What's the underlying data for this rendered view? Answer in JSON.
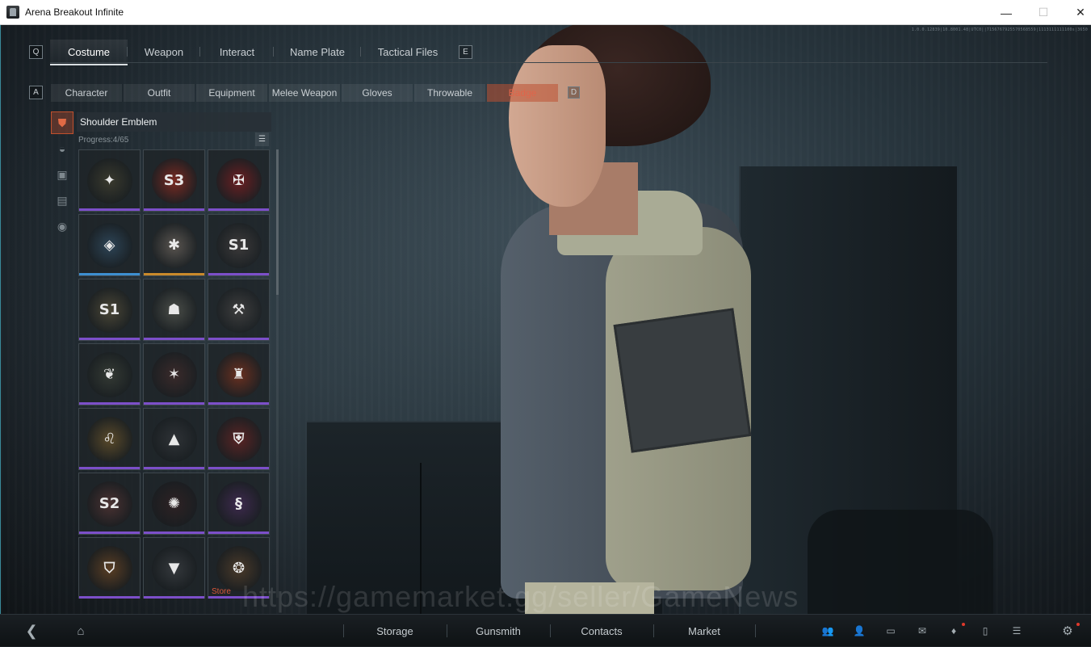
{
  "window": {
    "title": "Arena Breakout Infinite",
    "min": "—",
    "max": "☐",
    "close": "✕"
  },
  "build_string": "1.0.0.12839|10.8001.48|UTC0||7156767925570568559|1113111111100s|3650",
  "top_tabs": {
    "left_key": "Q",
    "right_key": "E",
    "items": [
      "Costume",
      "Weapon",
      "Interact",
      "Name Plate",
      "Tactical Files"
    ],
    "active": "Costume"
  },
  "sub_tabs": {
    "left_key": "A",
    "right_key": "D",
    "items": [
      "Character",
      "Outfit",
      "Equipment",
      "Melee Weapon",
      "Gloves",
      "Throwable",
      "Badge"
    ],
    "active": "Badge"
  },
  "category_icons": [
    "jacket-icon",
    "helmet-icon",
    "vest-icon",
    "backpack-icon",
    "mask-icon"
  ],
  "panel": {
    "title": "Shoulder Emblem",
    "progress": "Progress:4/65",
    "store_label": "Store"
  },
  "emblems": [
    {
      "name": "emblem-wings",
      "glyph": "✦",
      "rarity": "#7c4fc9",
      "bg": "#3a3a2e"
    },
    {
      "name": "emblem-s3",
      "glyph": "S3",
      "rarity": "#7c4fc9",
      "bg": "#7a2a22"
    },
    {
      "name": "emblem-guitar-skull",
      "glyph": "✠",
      "rarity": "#7c4fc9",
      "bg": "#6b1f22"
    },
    {
      "name": "emblem-bear-shield",
      "glyph": "◈",
      "rarity": "#3d8fd0",
      "bg": "#2d4456"
    },
    {
      "name": "emblem-trauma-team",
      "glyph": "✱",
      "rarity": "#c98a2b",
      "bg": "#5a5550"
    },
    {
      "name": "emblem-s1-dark",
      "glyph": "S1",
      "rarity": "#7c4fc9",
      "bg": "#3c3a3a"
    },
    {
      "name": "emblem-s1-gold",
      "glyph": "S1",
      "rarity": "#7c4fc9",
      "bg": "#4a4636"
    },
    {
      "name": "emblem-camo-skull",
      "glyph": "☗",
      "rarity": "#7c4fc9",
      "bg": "#4a4d48"
    },
    {
      "name": "emblem-crossed-hammers",
      "glyph": "⚒",
      "rarity": "#7c4fc9",
      "bg": "#3e3e3e"
    },
    {
      "name": "emblem-feather",
      "glyph": "❦",
      "rarity": "#7c4fc9",
      "bg": "#343a34"
    },
    {
      "name": "emblem-star-arrows",
      "glyph": "✶",
      "rarity": "#7c4fc9",
      "bg": "#3a2a2a"
    },
    {
      "name": "emblem-orange-city",
      "glyph": "♜",
      "rarity": "#7c4fc9",
      "bg": "#6a3020"
    },
    {
      "name": "emblem-lion-medal",
      "glyph": "♌",
      "rarity": "#7c4fc9",
      "bg": "#5a4a2a"
    },
    {
      "name": "emblem-cyber-triangle",
      "glyph": "▲",
      "rarity": "#7c4fc9",
      "bg": "#2e3236"
    },
    {
      "name": "emblem-red-crest",
      "glyph": "⛨",
      "rarity": "#7c4fc9",
      "bg": "#5a2424"
    },
    {
      "name": "emblem-s2",
      "glyph": "S2",
      "rarity": "#7c4fc9",
      "bg": "#4a3232"
    },
    {
      "name": "emblem-red-spider",
      "glyph": "✺",
      "rarity": "#7c4fc9",
      "bg": "#2e2224"
    },
    {
      "name": "emblem-purple-snake",
      "glyph": "§",
      "rarity": "#7c4fc9",
      "bg": "#3e2a4e"
    },
    {
      "name": "emblem-tiger-shield",
      "glyph": "⛉",
      "rarity": "#7c4fc9",
      "bg": "#5a3e24"
    },
    {
      "name": "emblem-winged-chevron",
      "glyph": "▼",
      "rarity": "#7c4fc9",
      "bg": "#34383c"
    },
    {
      "name": "emblem-store-badge",
      "glyph": "❂",
      "rarity": "#7c4fc9",
      "bg": "#4a3a2a",
      "store": true
    }
  ],
  "watermark": "https://gamemarket.gg/seller/GameNews",
  "bottom_nav": {
    "items": [
      "Storage",
      "Gunsmith",
      "Contacts",
      "Market"
    ]
  },
  "colors": {
    "accent": "#e0654a",
    "rarity_purple": "#7c4fc9",
    "rarity_blue": "#3d8fd0",
    "rarity_orange": "#c98a2b"
  }
}
